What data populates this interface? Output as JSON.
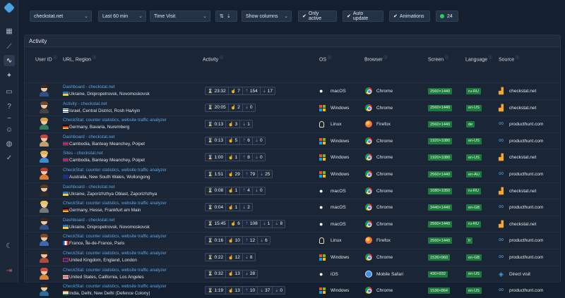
{
  "toolbar": {
    "site": "checkstat.net",
    "period": "Last 60 min",
    "sort": "Time Visit",
    "show_columns": "Show columns",
    "only_active": "Only active",
    "auto_update": "Auto update",
    "animations": "Animations",
    "online_count": "24"
  },
  "panel": {
    "title": "Activity"
  },
  "headers": {
    "user_id": "User ID",
    "url_region": "URL, Region",
    "activity": "Activity",
    "os": "OS",
    "browser": "Browser",
    "screen": "Screen",
    "language": "Language",
    "source": "Source"
  },
  "rows": [
    {
      "url": "Dashboard - checkstat.net",
      "region": "Ukraine, Dnipropetrovsk, Novomoskovsk",
      "flag": "ua",
      "time": "23:32",
      "clicks": "7",
      "up": "154",
      "down": "17",
      "os": "macOS",
      "browser": "Chrome",
      "screen": "2560×1440",
      "lang": "ru-RU",
      "source": "checkstat.net",
      "src_icon": "chart-source-icon",
      "avatar": "a"
    },
    {
      "url": "Activity - checkstat.net",
      "region": "Israel, Central District, Rosh HaAyin",
      "flag": "il",
      "time": "20:05",
      "clicks": "2",
      "up": "",
      "down": "0",
      "os": "Windows",
      "browser": "Chrome",
      "screen": "2560×1440",
      "lang": "en-US",
      "source": "checkstat.net",
      "src_icon": "chart-source-icon",
      "avatar": "b"
    },
    {
      "url": "CheckStat: counter statistics, website traffic analyzer",
      "region": "Germany, Bavaria, Nuremberg",
      "flag": "de",
      "time": "0:13",
      "clicks": "3",
      "up": "",
      "down": "1",
      "os": "Linux",
      "browser": "Firefox",
      "screen": "2560×1440",
      "lang": "de",
      "source": "producthunt.com",
      "src_icon": "link-source-icon",
      "avatar": "c"
    },
    {
      "url": "Dashboard - checkstat.net",
      "region": "Cambodia, Banteay Meanchey, Poipet",
      "flag": "kh",
      "time": "0:13",
      "clicks": "5",
      "up": "6",
      "down": "0",
      "os": "Windows",
      "browser": "Chrome",
      "screen": "1920×1080",
      "lang": "en-US",
      "source": "producthunt.com",
      "src_icon": "link-source-icon",
      "avatar": "d"
    },
    {
      "url": "Sites - checkstat.net",
      "region": "Cambodia, Banteay Meanchey, Poipet",
      "flag": "kh",
      "time": "1:00",
      "clicks": "1",
      "up": "8",
      "down": "0",
      "os": "Windows",
      "browser": "Chrome",
      "screen": "1920×1080",
      "lang": "en-US",
      "source": "checkstat.net",
      "src_icon": "chart-source-icon",
      "avatar": "e"
    },
    {
      "url": "CheckStat: counter statistics, website traffic analyzer",
      "region": "Australia, New South Wales, Wollongong",
      "flag": "au",
      "time": "1:51",
      "clicks": "29",
      "up": "79",
      "down": "25",
      "os": "Windows",
      "browser": "Chrome",
      "screen": "2560×1440",
      "lang": "en-AU",
      "source": "producthunt.com",
      "src_icon": "link-source-icon",
      "avatar": "f"
    },
    {
      "url": "Dashboard - checkstat.net",
      "region": "Ukraine, Zaporizhzhya Oblast, Zaporizhzhya",
      "flag": "ua",
      "time": "0:08",
      "clicks": "1",
      "up": "4",
      "down": "0",
      "os": "macOS",
      "browser": "Chrome",
      "screen": "1680×1050",
      "lang": "ru-RU",
      "source": "checkstat.net",
      "src_icon": "chart-source-icon",
      "avatar": "g"
    },
    {
      "url": "CheckStat: counter statistics, website traffic analyzer",
      "region": "Germany, Hesse, Frankfurt am Main",
      "flag": "de",
      "time": "0:04",
      "clicks": "1",
      "up": "",
      "down": "2",
      "os": "macOS",
      "browser": "Chrome",
      "screen": "3440×1440",
      "lang": "en-GB",
      "source": "producthunt.com",
      "src_icon": "link-source-icon",
      "avatar": "h"
    },
    {
      "url": "Dashboard - checkstat.net",
      "region": "Ukraine, Dnipropetrovsk, Novomoskovsk",
      "flag": "ua",
      "time": "15:45",
      "clicks": "6",
      "up": "108",
      "down": "1",
      "extra": "8",
      "os": "macOS",
      "browser": "Chrome",
      "screen": "2560×1440",
      "lang": "ru-RU",
      "source": "checkstat.net",
      "src_icon": "chart-source-icon",
      "avatar": "a"
    },
    {
      "url": "CheckStat: counter statistics, website traffic analyzer",
      "region": "France, Île-de-France, Paris",
      "flag": "fr",
      "time": "0:16",
      "clicks": "10",
      "up": "12",
      "down": "6",
      "os": "Linux",
      "browser": "Firefox",
      "screen": "2560×1440",
      "lang": "fr",
      "source": "producthunt.com",
      "src_icon": "link-source-icon",
      "avatar": "i"
    },
    {
      "url": "CheckStat: counter statistics, website traffic analyzer",
      "region": "United Kingdom, England, London",
      "flag": "gb",
      "time": "0:22",
      "clicks": "12",
      "up": "",
      "down": "8",
      "os": "Windows",
      "browser": "Chrome",
      "screen": "1536×960",
      "lang": "en-GB",
      "source": "producthunt.com",
      "src_icon": "link-source-icon",
      "avatar": "j"
    },
    {
      "url": "CheckStat: counter statistics, website traffic analyzer",
      "region": "United States, California, Los Angeles",
      "flag": "us",
      "time": "0:32",
      "clicks": "13",
      "up": "",
      "down": "28",
      "os": "iOS",
      "browser": "Mobile Safari",
      "screen": "430×932",
      "lang": "en-US",
      "source": "Direct visit",
      "src_icon": "direct-source-icon",
      "avatar": "k"
    },
    {
      "url": "CheckStat: counter statistics, website traffic analyzer",
      "region": "India, Delhi, New Delhi (Defence Colony)",
      "flag": "in",
      "time": "1:19",
      "clicks": "13",
      "up": "10",
      "down": "37",
      "extra": "0",
      "os": "Windows",
      "browser": "Chrome",
      "screen": "1536×864",
      "lang": "en-US",
      "source": "producthunt.com",
      "src_icon": "link-source-icon",
      "avatar": "l"
    }
  ],
  "colors": {
    "accent": "#5aa7e6",
    "badge_green": "#1e7a3c",
    "online_dot": "#2ecc5c"
  }
}
